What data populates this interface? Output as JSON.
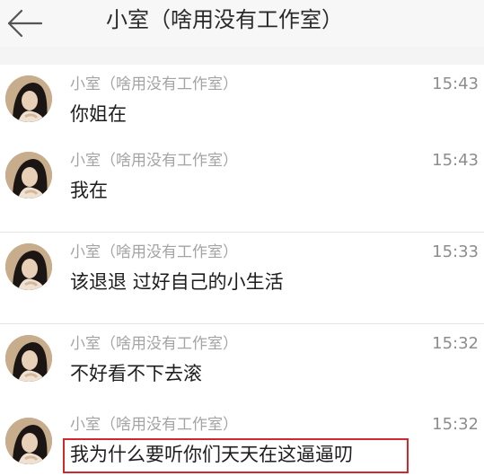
{
  "header": {
    "back_icon": "arrow-left-icon",
    "title": "小室（啥用没有工作室）"
  },
  "messages": [
    {
      "sender": "小室（啥用没有工作室）",
      "time": "15:43",
      "text": "你姐在"
    },
    {
      "sender": "小室（啥用没有工作室）",
      "time": "15:43",
      "text": "我在"
    },
    {
      "sender": "小室（啥用没有工作室）",
      "time": "15:33",
      "text": "该退退 过好自己的小生活"
    },
    {
      "sender": "小室（啥用没有工作室）",
      "time": "15:32",
      "text": "不好看不下去滚"
    },
    {
      "sender": "小室（啥用没有工作室）",
      "time": "15:32",
      "text": "我为什么要听你们天天在这逼逼叨"
    }
  ],
  "colors": {
    "highlight": "#d3262d",
    "sender": "#a4a4a4",
    "message": "#1e1e1e"
  }
}
